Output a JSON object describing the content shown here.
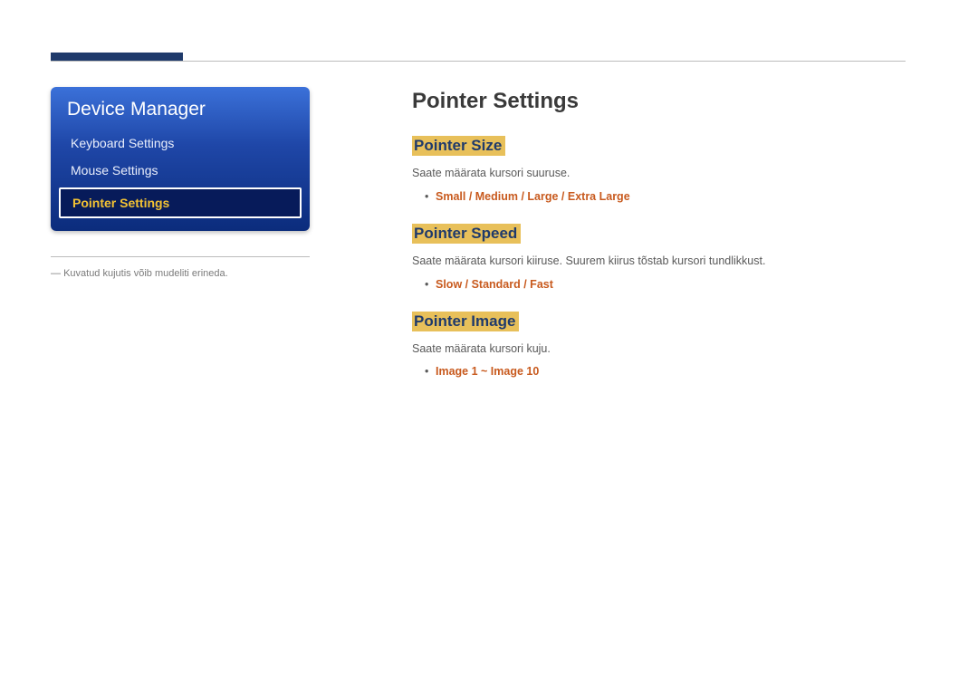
{
  "sidebar": {
    "title": "Device Manager",
    "items": [
      {
        "label": "Keyboard Settings",
        "selected": false
      },
      {
        "label": "Mouse Settings",
        "selected": false
      },
      {
        "label": "Pointer Settings",
        "selected": true
      }
    ],
    "footnote": "Kuvatud kujutis võib mudeliti erineda."
  },
  "content": {
    "title": "Pointer Settings",
    "sections": [
      {
        "title": "Pointer Size",
        "desc": "Saate määrata kursori suuruse.",
        "options": "Small / Medium / Large / Extra Large"
      },
      {
        "title": "Pointer Speed",
        "desc": "Saate määrata kursori kiiruse. Suurem kiirus tõstab kursori tundlikkust.",
        "options": "Slow / Standard / Fast"
      },
      {
        "title": "Pointer Image",
        "desc": "Saate määrata kursori kuju.",
        "options": "Image 1 ~ Image 10"
      }
    ]
  }
}
